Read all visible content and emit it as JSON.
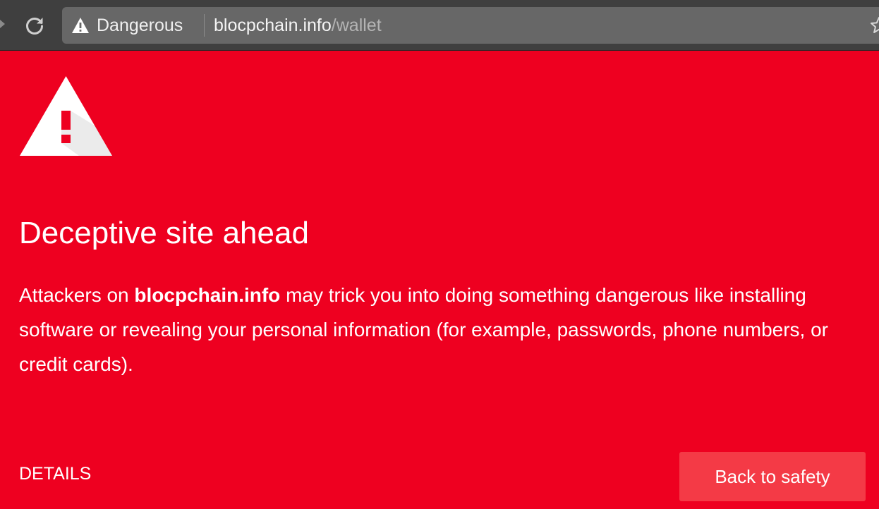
{
  "browser": {
    "security_state": "Dangerous",
    "url_host": "blocpchain.info",
    "url_path": "/wallet"
  },
  "icons": {
    "back": "back-arrow-icon",
    "reload": "reload-icon",
    "security": "warning-triangle-icon",
    "bookmark": "star-icon",
    "page": "warning-triangle-icon"
  },
  "interstitial": {
    "title": "Deceptive site ahead",
    "message": {
      "prefix": "Attackers on ",
      "site": "blocpchain.info",
      "suffix": " may trick you into doing something dangerous like installing software or revealing your personal information (for example, passwords, phone numbers, or credit cards)."
    },
    "details_label": "DETAILS",
    "back_button_label": "Back to safety"
  },
  "colors": {
    "background": "#ee0020",
    "button": "#f43a46",
    "toolbar": "#3f3f3f",
    "omnibox": "#676767"
  }
}
